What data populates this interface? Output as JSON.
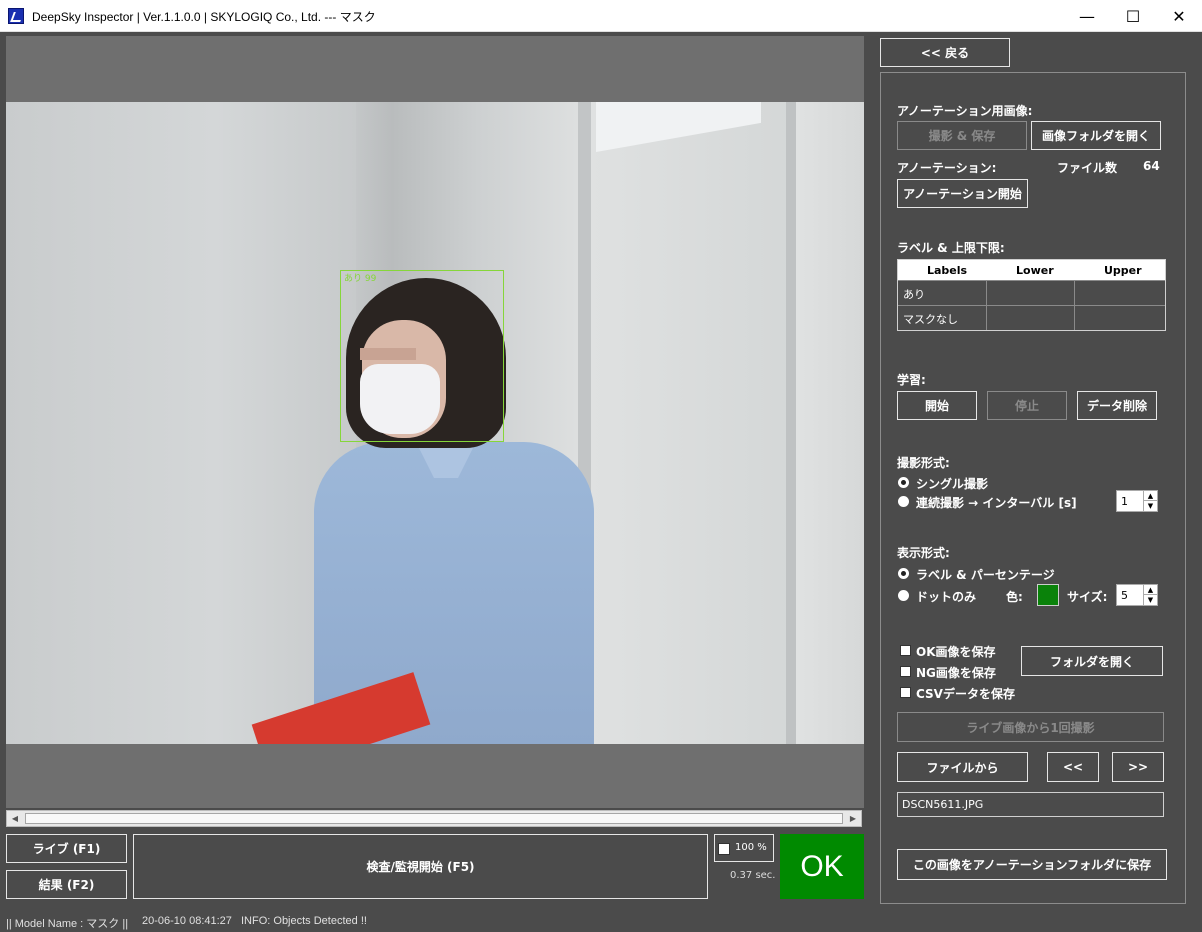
{
  "window": {
    "title": "DeepSky Inspector | Ver.1.1.0.0 | SKYLOGIQ Co., Ltd. --- マスク",
    "minimize": "—",
    "maximize": "☐",
    "close": "✕"
  },
  "viewer": {
    "detection_label": "あり 99"
  },
  "bottom": {
    "live_button": "ライブ (F1)",
    "result_button": "結果 (F2)",
    "inspect_button": "検査/監視開始 (F5)",
    "zoom_value": "100 %",
    "elapsed": "0.37 sec.",
    "result": "OK",
    "result_color": "#008a00"
  },
  "status": {
    "model": "|| Model Name : マスク ||",
    "datetime": "20-06-10 08:41:27",
    "info": "INFO:  Objects Detected !!"
  },
  "panel": {
    "back_button": "<< 戻る",
    "annot_image_title": "アノーテーション用画像:",
    "capture_save_button": "撮影 & 保存",
    "open_image_folder_button": "画像フォルダを開く",
    "annotation_title": "アノーテーション:",
    "file_count_label": "ファイル数",
    "file_count": "64",
    "start_annotation_button": "アノーテーション開始",
    "labels_title": "ラベル & 上限下限:",
    "table": {
      "headers": [
        "Labels",
        "Lower",
        "Upper"
      ],
      "rows": [
        [
          "あり",
          "",
          ""
        ],
        [
          "マスクなし",
          "",
          ""
        ]
      ]
    },
    "learning_title": "学習:",
    "learn_start": "開始",
    "learn_stop": "停止",
    "learn_delete": "データ削除",
    "capture_mode_title": "撮影形式:",
    "capture_single": "シングル撮影",
    "capture_continuous": "連続撮影 → インターバル [s]",
    "interval_value": "1",
    "display_mode_title": "表示形式:",
    "display_label_percent": "ラベル & パーセンテージ",
    "display_dot_only": "ドットのみ",
    "color_label": "色:",
    "dot_color": "#0a820a",
    "size_label": "サイズ:",
    "size_value": "5",
    "save_ok": "OK画像を保存",
    "save_ng": "NG画像を保存",
    "save_csv": "CSVデータを保存",
    "open_folder_button": "フォルダを開く",
    "capture_once_button": "ライブ画像から1回撮影",
    "from_file_button": "ファイルから",
    "prev_button": "<<",
    "next_button": ">>",
    "file_name": "DSCN5611.JPG",
    "save_to_annot_button": "この画像をアノーテーションフォルダに保存"
  }
}
